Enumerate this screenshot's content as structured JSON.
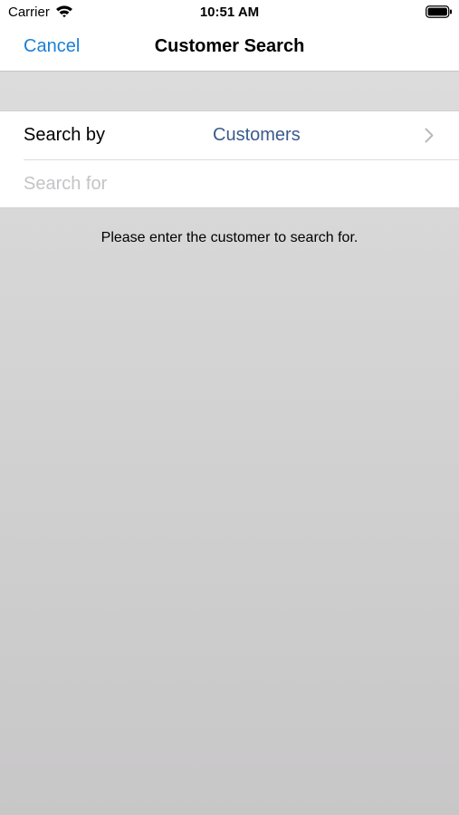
{
  "status_bar": {
    "carrier": "Carrier",
    "time": "10:51 AM",
    "wifi_icon": "wifi-icon",
    "battery_icon": "battery-icon"
  },
  "nav": {
    "cancel_label": "Cancel",
    "title": "Customer Search"
  },
  "form": {
    "search_by_label": "Search by",
    "search_by_value": "Customers",
    "chevron_icon": "chevron-right-icon",
    "search_for_value": "",
    "search_for_placeholder": "Search for"
  },
  "hint": "Please enter the customer to search for.",
  "colors": {
    "accent": "#1a7fd6",
    "value_text": "#3a5b8c",
    "placeholder": "#c4c4c7",
    "background": "#d6d6d6"
  }
}
